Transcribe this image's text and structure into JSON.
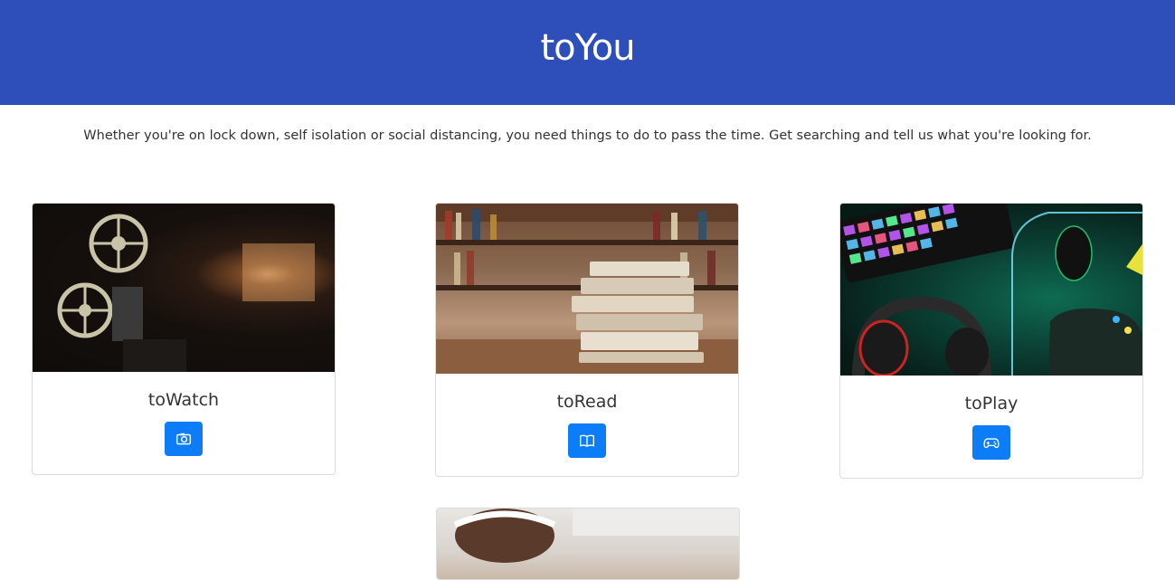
{
  "header": {
    "logo": "toYou",
    "bg_color": "#2e4fba"
  },
  "tagline": "Whether you're on lock down, self isolation or social distancing, you need things to do to pass the time. Get searching and tell us what you're looking for.",
  "cards": [
    {
      "title": "toWatch",
      "icon": "camera-icon",
      "image": "film-projector-photo"
    },
    {
      "title": "toRead",
      "icon": "book-icon",
      "image": "books-stack-photo"
    },
    {
      "title": "toPlay",
      "icon": "gamepad-icon",
      "image": "gaming-setup-photo"
    },
    {
      "title": "",
      "icon": "",
      "image": "person-lying-photo"
    }
  ],
  "accent_color": "#0d7df7"
}
